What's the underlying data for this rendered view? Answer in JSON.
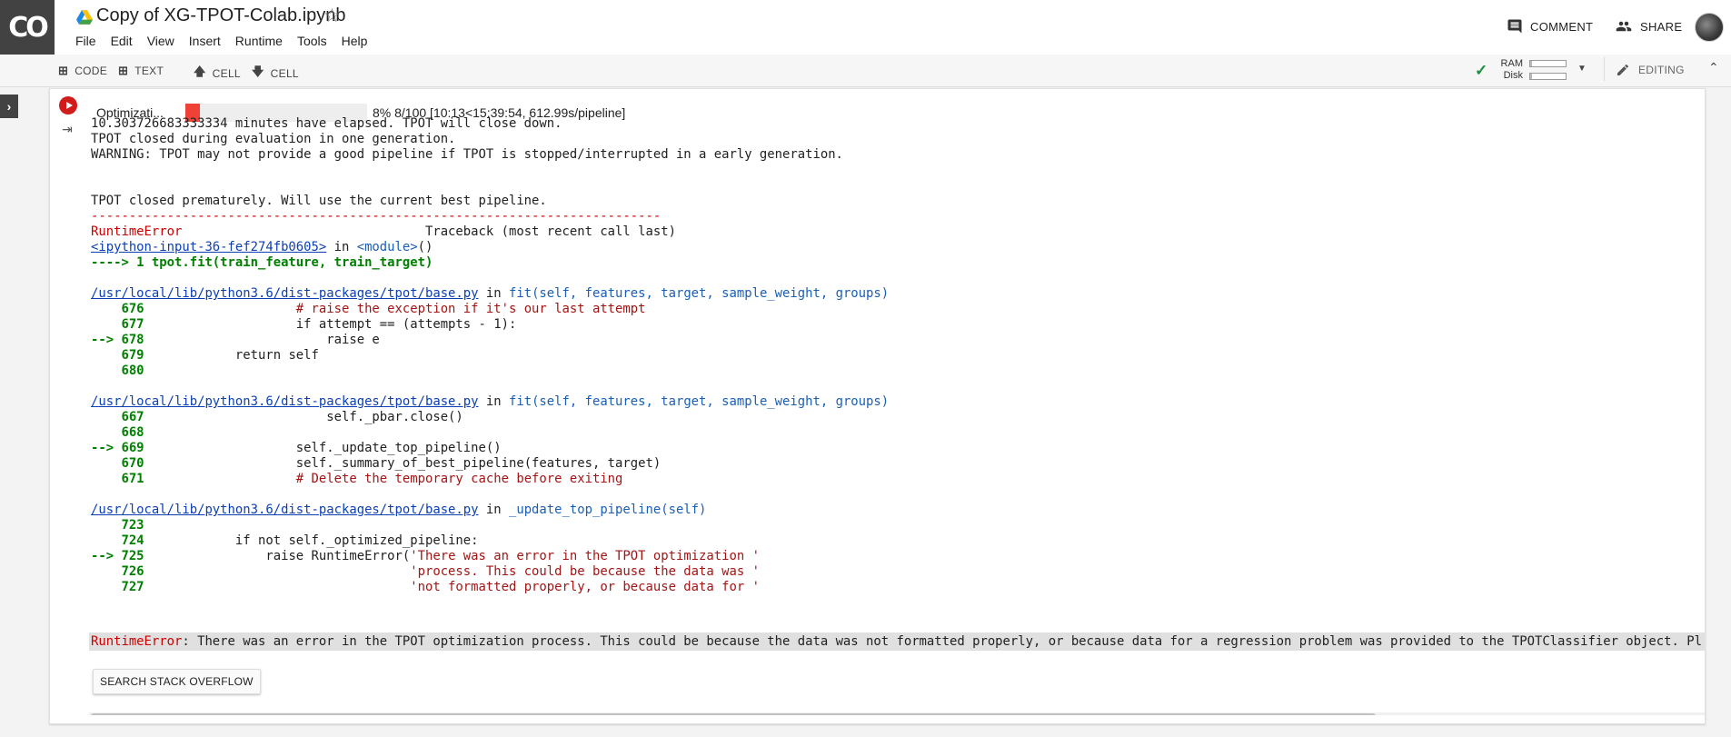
{
  "app": {
    "logo_text": "CO"
  },
  "notebook": {
    "title": "Copy of XG-TPOT-Colab.ipynb"
  },
  "menu": [
    "File",
    "Edit",
    "View",
    "Insert",
    "Runtime",
    "Tools",
    "Help"
  ],
  "header_actions": {
    "comment": "COMMENT",
    "share": "SHARE"
  },
  "toolbar": {
    "code": "CODE",
    "text": "TEXT",
    "cell_up": "CELL",
    "cell_down": "CELL",
    "ram_label": "RAM",
    "disk_label": "Disk",
    "ram_usage": 0.05,
    "disk_usage": 0.05,
    "editing": "EDITING"
  },
  "progress": {
    "label": "Optimizati...",
    "fraction": 0.08,
    "text": "8% 8/100 [10:13<15:39:54, 612.99s/pipeline]"
  },
  "output": {
    "l1": "10.303726683333334 minutes have elapsed. TPOT will close down.",
    "l2": "TPOT closed during evaluation in one generation.",
    "l3": "WARNING: TPOT may not provide a good pipeline if TPOT is stopped/interrupted in a early generation.",
    "l4": "TPOT closed prematurely. Will use the current best pipeline.",
    "dashes": "---------------------------------------------------------------------------",
    "err_type": "RuntimeError",
    "traceback": "                                Traceback (most recent call last)",
    "input_link": "<ipython-input-36-fef274fb0605>",
    "in_word": " in ",
    "module": "<module>",
    "paren": "()",
    "arrow_line": "----> 1 tpot.fit(train_feature, train_target)",
    "base_path": "/usr/local/lib/python3.6/dist-packages/tpot/base.py",
    "fit_sig_name": "fit",
    "fit_sig_args": "(self, features, target, sample_weight, groups)",
    "f1": {
      "n676": "    676",
      "c676": "                    # raise the exception if it's our last attempt",
      "n677": "    677",
      "c677": "                    if attempt == (attempts - 1):",
      "n678": "--> 678",
      "c678": "                        raise e",
      "n679": "    679",
      "c679": "            return self",
      "n680": "    680"
    },
    "f2": {
      "n667": "    667",
      "c667": "                        self._pbar.close()",
      "n668": "    668",
      "n669": "--> 669",
      "c669": "                    self._update_top_pipeline()",
      "n670": "    670",
      "c670": "                    self._summary_of_best_pipeline(features, target)",
      "n671": "    671",
      "c671": "                    # Delete the temporary cache before exiting"
    },
    "f3_name": "_update_top_pipeline",
    "f3_args": "(self)",
    "f3": {
      "n723": "    723",
      "n724": "    724",
      "c724": "            if not self._optimized_pipeline:",
      "n725": "--> 725",
      "c725_a": "                raise RuntimeError(",
      "c725_b": "'There was an error in the TPOT optimization '",
      "n726": "    726",
      "c726": "                                   'process. This could be because the data was '",
      "n727": "    727",
      "c727": "                                   'not formatted properly, or because data for '"
    },
    "final_err_type": "RuntimeError",
    "final_err_msg": ": There was an error in the TPOT optimization process. This could be because the data was not formatted properly, or because data for a regression problem was provided to the TPOTClassifier object. Pl"
  },
  "stack_overflow_button": "SEARCH STACK OVERFLOW",
  "colors": {
    "run_button": "#d21c1c",
    "progress_fill": "#ef4135",
    "error_red": "#cc0000"
  }
}
